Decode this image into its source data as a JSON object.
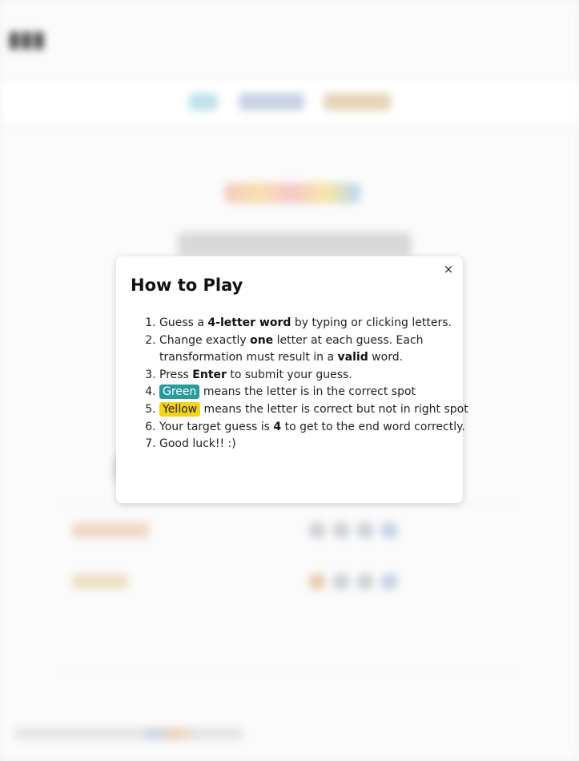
{
  "modal": {
    "title": "How to Play",
    "close_icon": "×",
    "steps": [
      {
        "pre": "Guess a ",
        "bold": "4-letter word",
        "post": " by typing or clicking letters."
      },
      {
        "pre": "Change exactly ",
        "bold": "one",
        "mid": " letter at each guess. Each transformation must result in a ",
        "bold2": "valid",
        "post": " word."
      },
      {
        "pre": "Press ",
        "bold": "Enter",
        "post": " to submit your guess."
      },
      {
        "tag": "Green",
        "post": " means the letter is in the correct spot"
      },
      {
        "tag": "Yellow",
        "post": " means the letter is correct but not in right spot"
      },
      {
        "pre": "Your target guess is ",
        "bold": "4",
        "post": " to get to the end word correctly."
      },
      {
        "pre": "Good luck!! :)"
      }
    ]
  },
  "colors": {
    "green_tag": "#2a9a9c",
    "yellow_tag": "#f4d11a"
  }
}
